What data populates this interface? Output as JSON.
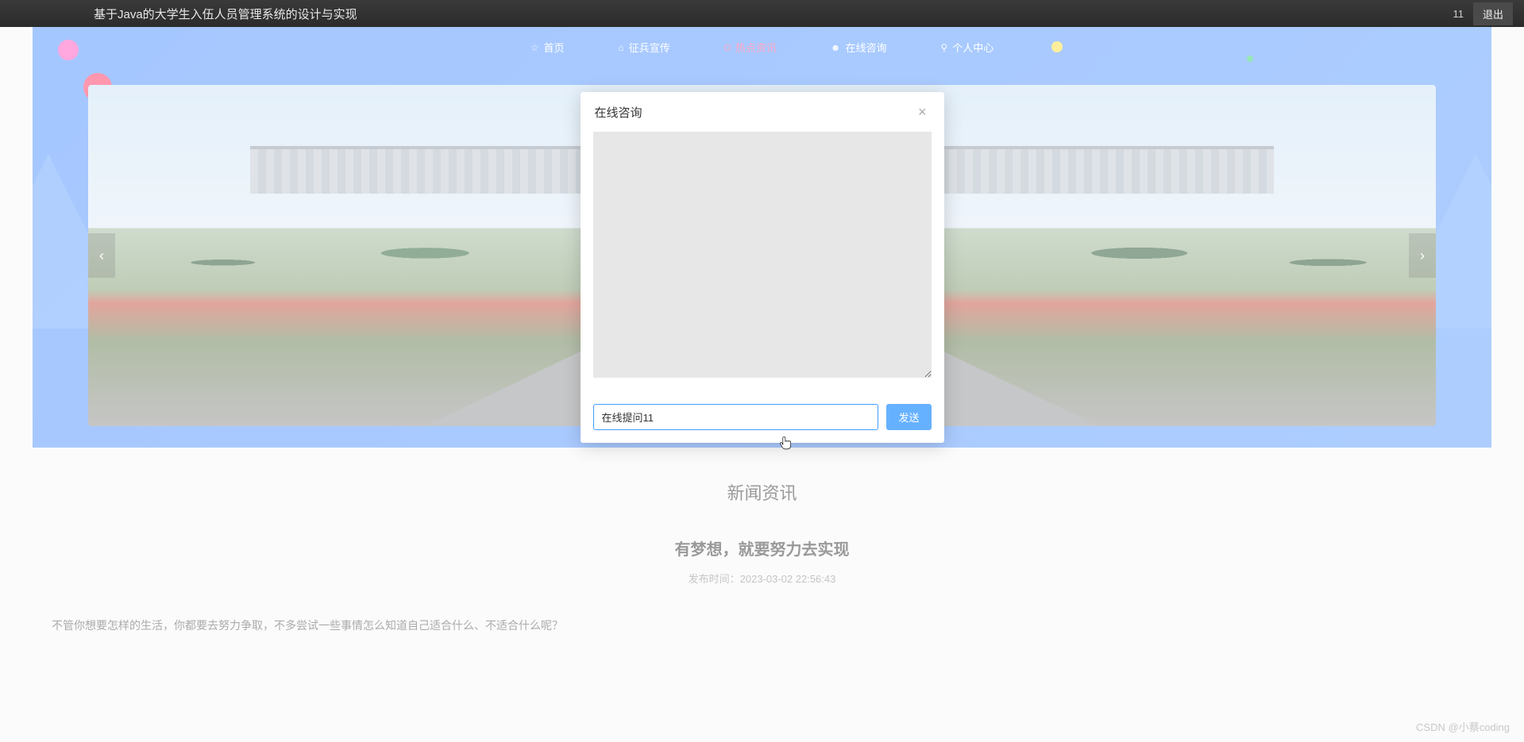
{
  "header": {
    "site_title": "基于Java的大学生入伍人员管理系统的设计与实现",
    "username": "11",
    "logout": "退出"
  },
  "nav": {
    "items": [
      {
        "label": "首页",
        "icon": "☆",
        "active": false
      },
      {
        "label": "征兵宣传",
        "icon": "⌂",
        "active": false
      },
      {
        "label": "热点资讯",
        "icon": "●",
        "active": true
      },
      {
        "label": "在线咨询",
        "icon": "☻",
        "active": false
      },
      {
        "label": "个人中心",
        "icon": "⚲",
        "active": false
      }
    ]
  },
  "news": {
    "section_title": "新闻资讯",
    "article_title": "有梦想，就要努力去实现",
    "meta_label": "发布时间：",
    "publish_time": "2023-03-02 22:56:43",
    "body": "不管你想要怎样的生活，你都要去努力争取，不多尝试一些事情怎么知道自己适合什么、不适合什么呢？"
  },
  "dialog": {
    "title": "在线咨询",
    "log_value": "",
    "input_value": "在线提问11",
    "send": "发送"
  },
  "watermark": "CSDN @小蔡coding"
}
